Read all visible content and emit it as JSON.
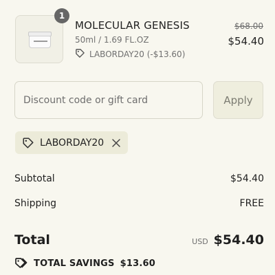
{
  "product": {
    "quantity": "1",
    "name": "MOLECULAR GENESIS",
    "variant": "50ml / 1.69 FL.OZ",
    "discount_line": "LABORDAY20 (-$13.60)",
    "original_price": "$68.00",
    "sale_price": "$54.40"
  },
  "discount_input": {
    "placeholder": "Discount code or gift card",
    "value": ""
  },
  "apply_label": "Apply",
  "applied_code": "LABORDAY20",
  "summary": {
    "subtotal_label": "Subtotal",
    "subtotal_value": "$54.40",
    "shipping_label": "Shipping",
    "shipping_value": "FREE",
    "total_label": "Total",
    "currency": "USD",
    "total_value": "$54.40",
    "savings_label": "TOTAL SAVINGS",
    "savings_value": "$13.60"
  },
  "colors": {
    "background": "#f8f7ef",
    "chip_background": "#ecebd9",
    "badge": "#666666",
    "text": "#1f1f1f",
    "muted_text": "#707070"
  },
  "icons": [
    "tag-icon",
    "close-icon",
    "savings-tag-icon"
  ]
}
